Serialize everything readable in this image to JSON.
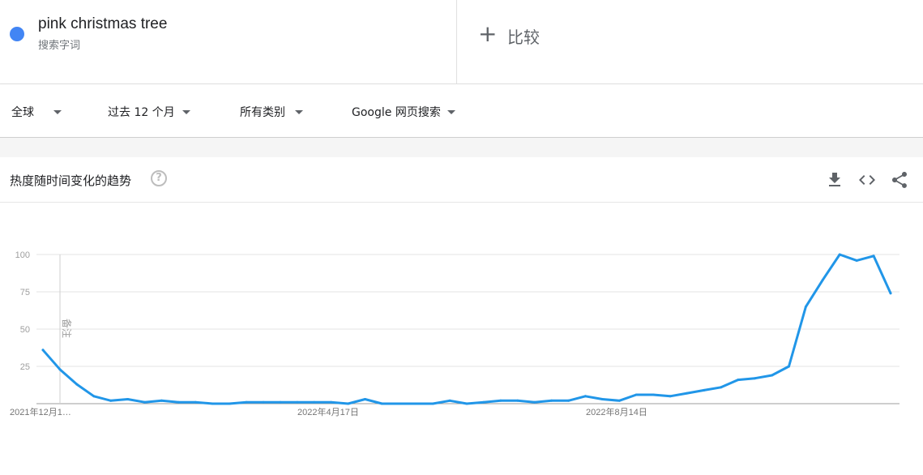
{
  "term": {
    "name": "pink christmas tree",
    "type": "搜索字词",
    "color": "#4285f4"
  },
  "compare": {
    "plus": "+",
    "label": "比较"
  },
  "filters": {
    "region": "全球",
    "time": "过去 12 个月",
    "category": "所有类别",
    "property": "Google 网页搜索"
  },
  "card": {
    "title": "热度随时间变化的趋势",
    "help": "?"
  },
  "icons": {
    "help": "help-circle-icon",
    "download": "download-icon",
    "embed": "embed-code-icon",
    "share": "share-icon"
  },
  "chart_data": {
    "type": "line",
    "y_ticks": [
      "25",
      "50",
      "75",
      "100"
    ],
    "ylim": [
      0,
      100
    ],
    "x_labels": [
      "2021年12月1…",
      "2022年4月17日",
      "2022年8月14日"
    ],
    "note_label": "备注",
    "line_color": "#2196e8",
    "series": [
      {
        "values": [
          36,
          23,
          13,
          5,
          2,
          3,
          1,
          2,
          1,
          1,
          0,
          0,
          1,
          1,
          1,
          1,
          1,
          1,
          0,
          3,
          0,
          0,
          0,
          0,
          2,
          0,
          1,
          2,
          2,
          1,
          2,
          2,
          5,
          3,
          2,
          6,
          6,
          5,
          7,
          9,
          11,
          16,
          17,
          19,
          25,
          65,
          83,
          100,
          96,
          99,
          74
        ]
      }
    ]
  }
}
